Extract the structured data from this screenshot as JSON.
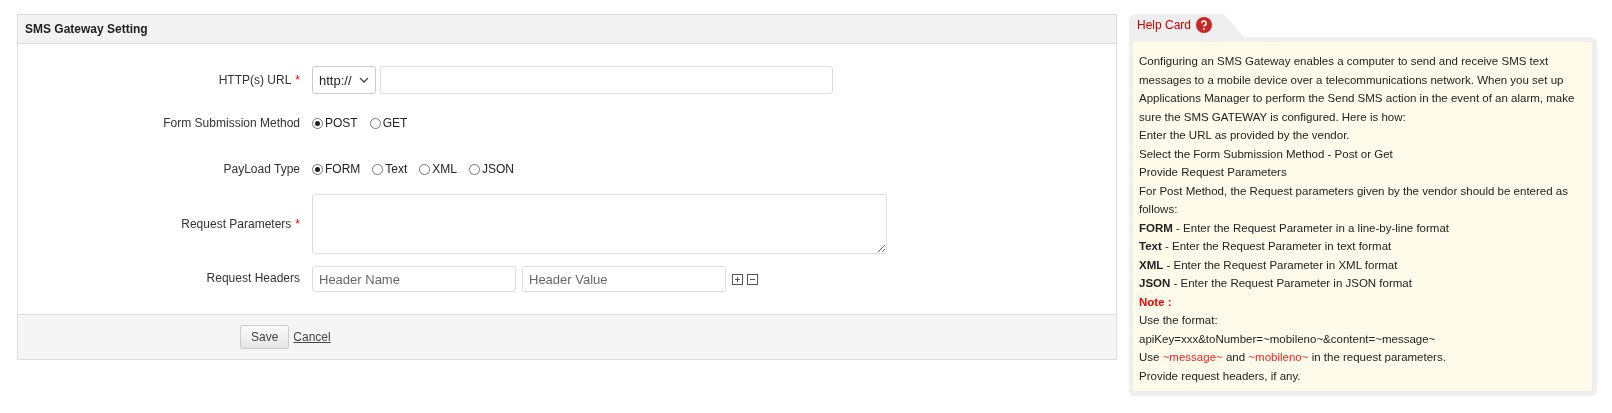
{
  "panel": {
    "title": "SMS Gateway Setting",
    "url": {
      "label": "HTTP(s) URL",
      "mark": "*",
      "protocol": "http://"
    },
    "method": {
      "label": "Form Submission Method",
      "options": [
        {
          "label": "POST",
          "selected": true
        },
        {
          "label": "GET",
          "selected": false
        }
      ]
    },
    "payload": {
      "label": "PayLoad Type",
      "options": [
        {
          "label": "FORM",
          "selected": true
        },
        {
          "label": "Text",
          "selected": false
        },
        {
          "label": "XML",
          "selected": false
        },
        {
          "label": "JSON",
          "selected": false
        }
      ]
    },
    "params": {
      "label": "Request Parameters",
      "mark": "*"
    },
    "headers": {
      "label": "Request Headers",
      "name_placeholder": "Header Name",
      "value_placeholder": "Header Value"
    },
    "buttons": {
      "save": "Save",
      "cancel": "Cancel"
    }
  },
  "help": {
    "title": "Help Card",
    "lines": [
      {
        "kind": "text",
        "text": "Configuring an SMS Gateway enables a computer to send and receive SMS text messages to a mobile device over a telecommunications network. When you set up Applications Manager to perform the Send SMS action in the event of an alarm, make sure the SMS GATEWAY is configured. Here is how:"
      },
      {
        "kind": "text",
        "text": "Enter the URL as provided by the vendor."
      },
      {
        "kind": "text",
        "text": "Select the Form Submission Method - Post or Get"
      },
      {
        "kind": "text",
        "text": "Provide Request Parameters"
      },
      {
        "kind": "text",
        "text": "For Post Method, the Request parameters given by the vendor should be entered as follows:"
      },
      {
        "kind": "text",
        "text": "**FORM** - Enter the Request Parameter in a line-by-line format"
      },
      {
        "kind": "text",
        "text": "**Text** - Enter the Request Parameter in text format"
      },
      {
        "kind": "text",
        "text": "**XML** - Enter the Request Parameter in XML format"
      },
      {
        "kind": "text",
        "text": "**JSON** - Enter the Request Parameter in JSON format"
      },
      {
        "kind": "note",
        "text": "Note :"
      },
      {
        "kind": "text",
        "text": "Use the format:"
      },
      {
        "kind": "text",
        "text": "apiKey=xxx&toNumber=~mobileno~&content=~message~"
      },
      {
        "kind": "parts",
        "parts": [
          {
            "text": "Use ",
            "highlight": false
          },
          {
            "text": "~message~",
            "highlight": true
          },
          {
            "text": " and ",
            "highlight": false
          },
          {
            "text": "~mobileno~",
            "highlight": true
          },
          {
            "text": " in the request parameters.",
            "highlight": false
          }
        ]
      },
      {
        "kind": "text",
        "text": "Provide request headers, if any."
      }
    ]
  }
}
